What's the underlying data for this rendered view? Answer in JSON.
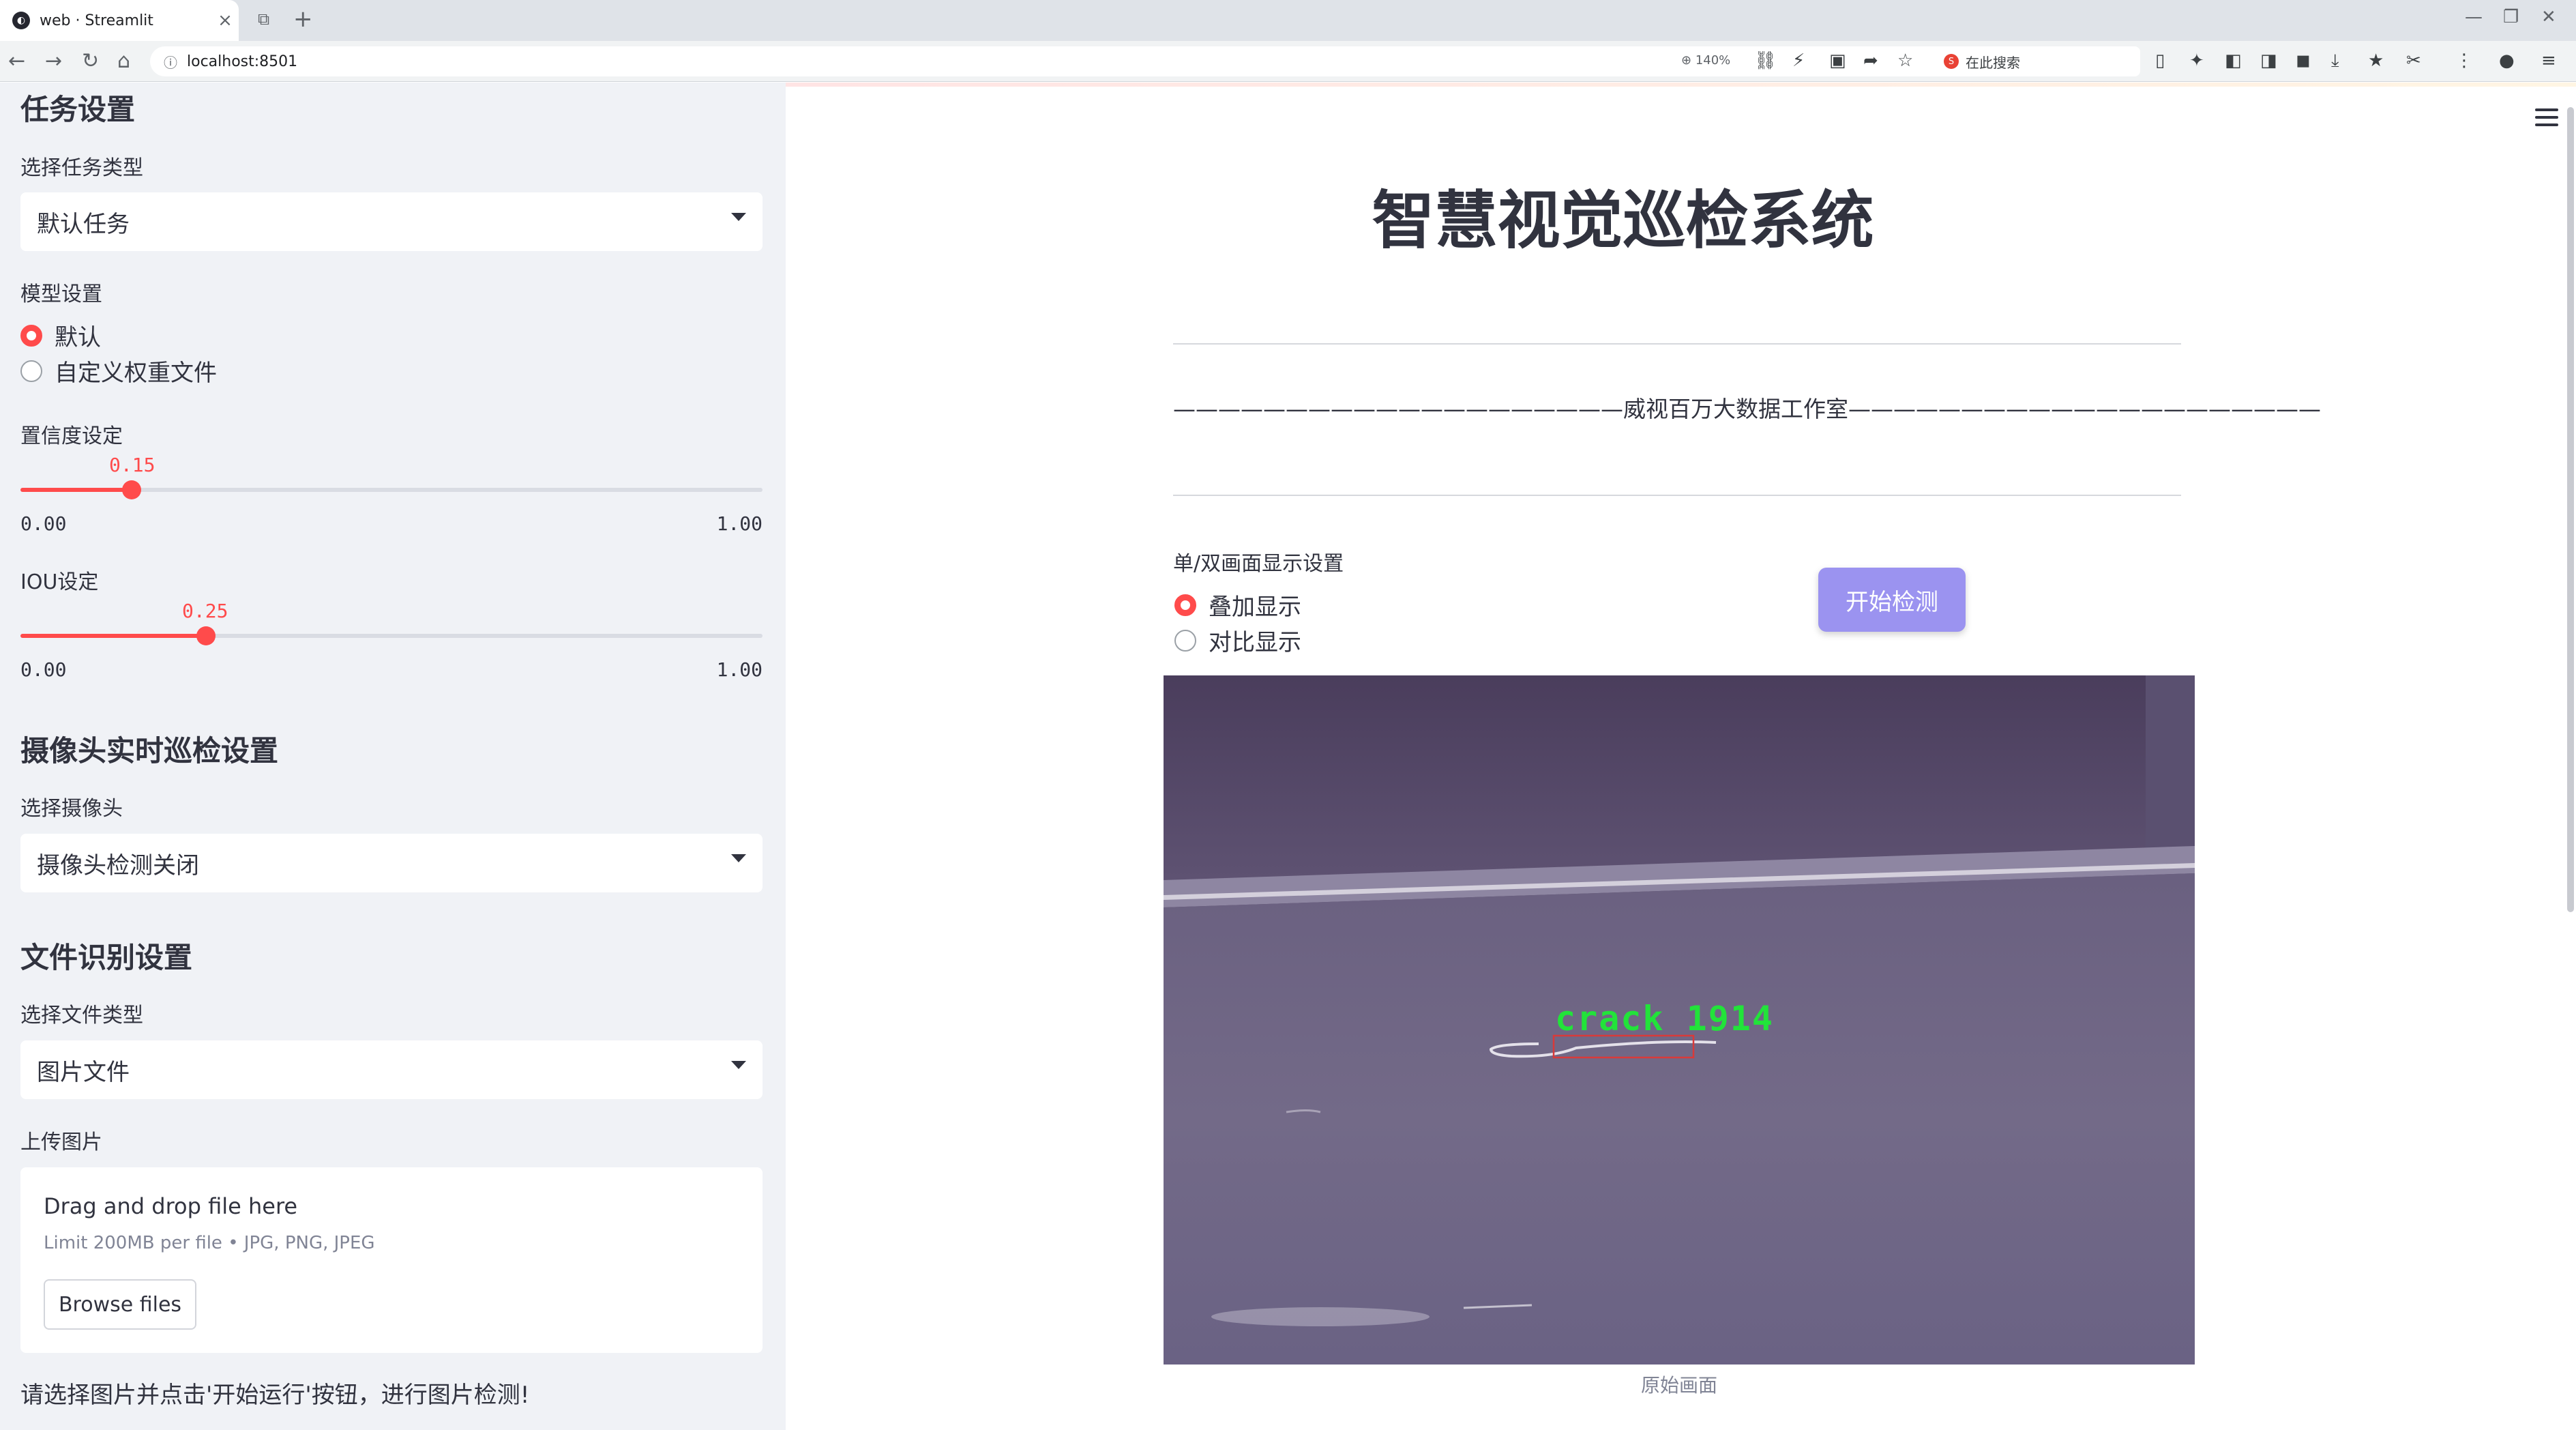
{
  "browser": {
    "tab_title": "web · Streamlit",
    "tab_favicon": "streamlit-logo",
    "url": "localhost:8501",
    "zoom": "140%",
    "search_placeholder": "在此搜索"
  },
  "sidebar": {
    "task_section_title": "任务设置",
    "task_type_label": "选择任务类型",
    "task_type_value": "默认任务",
    "model_label": "模型设置",
    "model_options": [
      "默认",
      "自定义权重文件"
    ],
    "model_selected": 0,
    "confidence_label": "置信度设定",
    "confidence": {
      "value": "0.15",
      "min": "0.00",
      "max": "1.00",
      "fraction": 0.15
    },
    "iou_label": "IOU设定",
    "iou": {
      "value": "0.25",
      "min": "0.00",
      "max": "1.00",
      "fraction": 0.25
    },
    "camera_section_title": "摄像头实时巡检设置",
    "camera_label": "选择摄像头",
    "camera_value": "摄像头检测关闭",
    "file_section_title": "文件识别设置",
    "file_type_label": "选择文件类型",
    "file_type_value": "图片文件",
    "upload_label": "上传图片",
    "dropzone_title": "Drag and drop file here",
    "dropzone_limit": "Limit 200MB per file • JPG, PNG, JPEG",
    "browse_label": "Browse files",
    "note": "请选择图片并点击'开始运行'按钮，进行图片检测!"
  },
  "main": {
    "title": "智慧视觉巡检系统",
    "studio_line": "————————————————————威视百万大数据工作室—————————————————————",
    "display_label": "单/双画面显示设置",
    "display_options": [
      "叠加显示",
      "对比显示"
    ],
    "display_selected": 0,
    "start_button": "开始检测",
    "detection_label": "crack  1914",
    "caption": "原始画面"
  },
  "colors": {
    "accent": "#ff4b4b",
    "button": "#9b93f0",
    "sidebar_bg": "#f0f2f6",
    "detection_text": "#22e33a",
    "detection_box": "#d83a3a"
  }
}
